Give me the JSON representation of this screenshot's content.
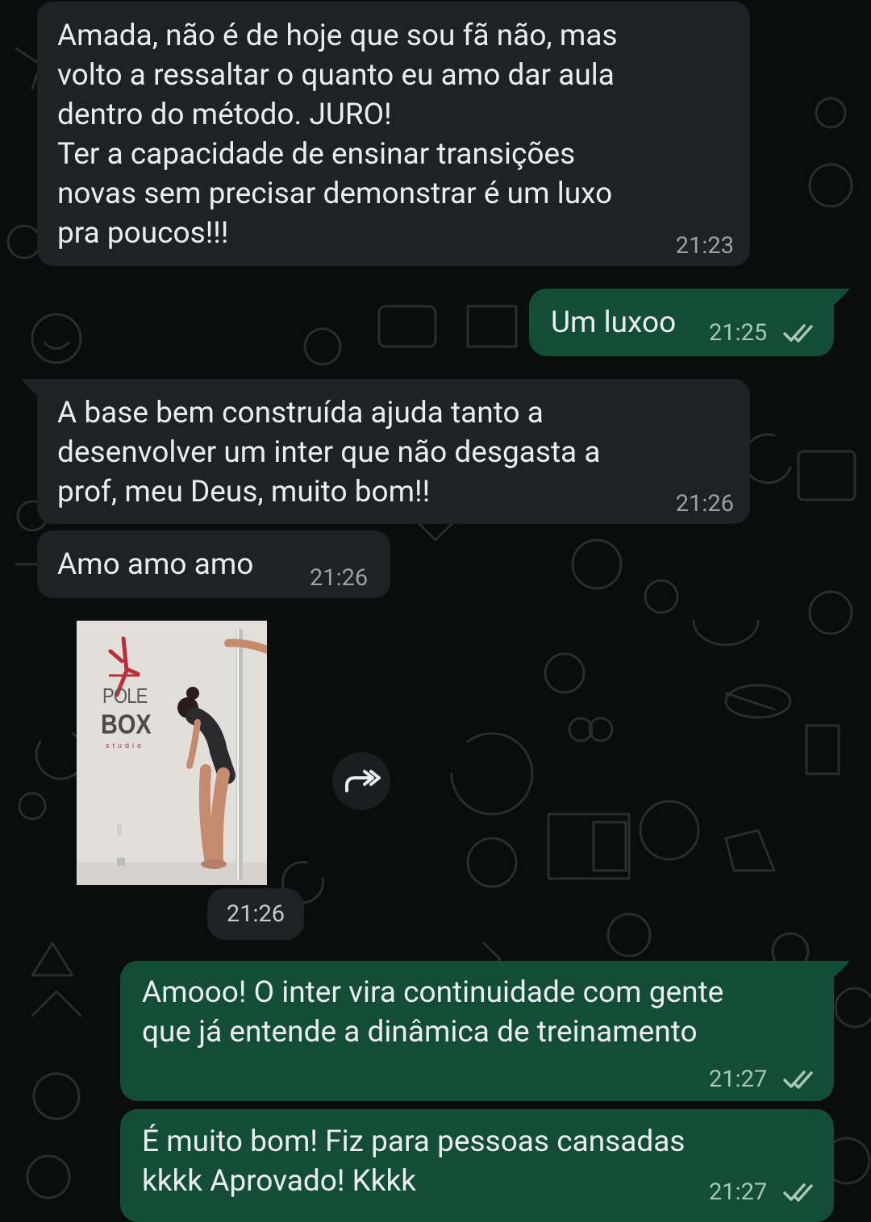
{
  "messages": [
    {
      "direction": "incoming",
      "text": "Amada, não é de hoje que sou fã não, mas\nvolto a ressaltar o quanto eu amo dar aula\ndentro do método. JURO!\nTer a capacidade de ensinar transições\nnovas sem precisar demonstrar é um luxo\npra poucos!!!",
      "time": "21:23"
    },
    {
      "direction": "outgoing",
      "text": "Um luxoo",
      "time": "21:25",
      "status": "read"
    },
    {
      "direction": "incoming",
      "text": "A base bem construída ajuda tanto a\ndesenvolver um inter que não desgasta a\nprof, meu Deus, muito bom!!",
      "time": "21:26"
    },
    {
      "direction": "incoming",
      "text": "Amo amo amo",
      "time": "21:26"
    },
    {
      "direction": "incoming",
      "type": "video",
      "time": "21:26",
      "brand_text": {
        "line1": "POLE",
        "line2": "BOX",
        "line3": "studio"
      }
    },
    {
      "direction": "outgoing",
      "text": "Amooo! O inter vira continuidade com gente\nque já entende a dinâmica de treinamento",
      "time": "21:27",
      "status": "read"
    },
    {
      "direction": "outgoing",
      "text": "É muito bom! Fiz para pessoas cansadas\nkkkk Aprovado! Kkkk",
      "time": "21:27",
      "status": "read"
    }
  ],
  "icons": {
    "forward": "forward-icon",
    "read_receipt": "double-check-icon"
  },
  "colors": {
    "background": "#0b0c0c",
    "incoming_bubble": "#1f2225",
    "outgoing_bubble": "#144d37",
    "text": "#e9edef",
    "timestamp": "#9aa2a6",
    "read_ticks": "#a8c7b9"
  }
}
